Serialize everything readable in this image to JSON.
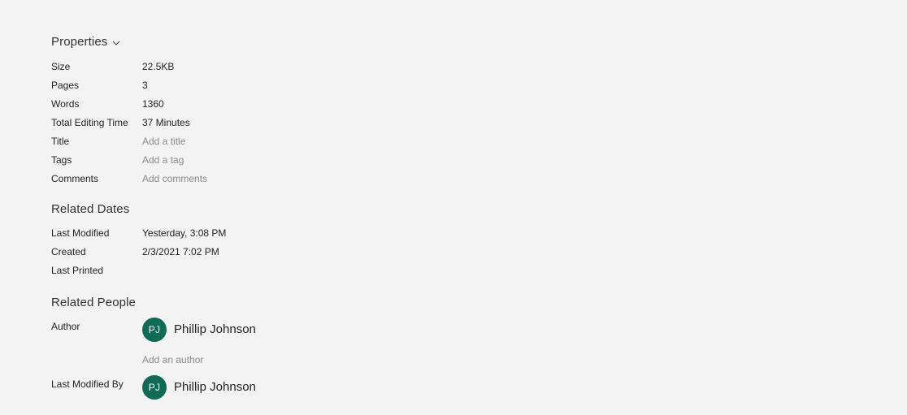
{
  "panel": {
    "background_color": "#f3f3f3",
    "accent_color": "#0f6b55"
  },
  "properties": {
    "heading": "Properties",
    "chevron_icon": "chevron-down-icon",
    "rows": [
      {
        "label": "Size",
        "value": "22.5KB",
        "is_placeholder": false
      },
      {
        "label": "Pages",
        "value": "3",
        "is_placeholder": false
      },
      {
        "label": "Words",
        "value": "1360",
        "is_placeholder": false
      },
      {
        "label": "Total Editing Time",
        "value": "37 Minutes",
        "is_placeholder": false
      },
      {
        "label": "Title",
        "value": "Add a title",
        "is_placeholder": true
      },
      {
        "label": "Tags",
        "value": "Add a tag",
        "is_placeholder": true
      },
      {
        "label": "Comments",
        "value": "Add comments",
        "is_placeholder": true
      }
    ]
  },
  "related_dates": {
    "heading": "Related Dates",
    "rows": [
      {
        "label": "Last Modified",
        "value": "Yesterday, 3:08 PM",
        "is_placeholder": false
      },
      {
        "label": "Created",
        "value": "2/3/2021 7:02 PM",
        "is_placeholder": false
      },
      {
        "label": "Last Printed",
        "value": "",
        "is_placeholder": false
      }
    ]
  },
  "related_people": {
    "heading": "Related People",
    "author": {
      "label": "Author",
      "person": {
        "initials": "PJ",
        "name": "Phillip Johnson",
        "avatar_color": "#0f6b55"
      },
      "add_author_placeholder": "Add an author"
    },
    "last_modified_by": {
      "label": "Last Modified By",
      "person": {
        "initials": "PJ",
        "name": "Phillip Johnson",
        "avatar_color": "#0f6b55"
      }
    }
  }
}
